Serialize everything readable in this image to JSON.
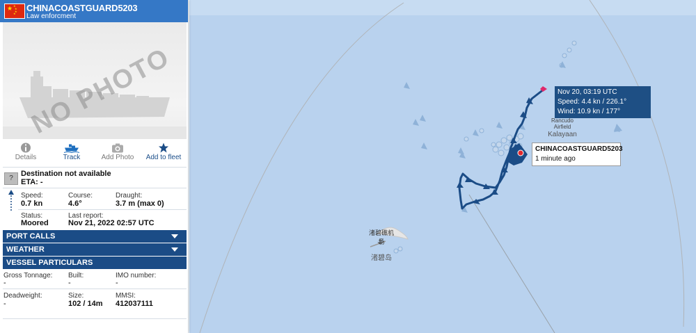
{
  "vessel": {
    "name": "CHINACOASTGUARD5203",
    "type": "Law enforcment",
    "flag_color": "#de2910"
  },
  "photo": {
    "watermark": "NO PHOTO"
  },
  "actions": [
    {
      "label": "Details",
      "icon": "info-icon"
    },
    {
      "label": "Track",
      "icon": "ship-icon"
    },
    {
      "label": "Add Photo",
      "icon": "camera-icon"
    },
    {
      "label": "Add to fleet",
      "icon": "star-icon"
    }
  ],
  "destination": {
    "icon_text": "?",
    "text": "Destination not available",
    "eta": "ETA: -"
  },
  "nav": {
    "speed_label": "Speed:",
    "speed": "0.7 kn",
    "course_label": "Course:",
    "course": "4.6°",
    "draught_label": "Draught:",
    "draught": "3.7 m (max 0)",
    "status_label": "Status:",
    "status": "Moored",
    "report_label": "Last report:",
    "report": "Nov 21, 2022 02:57 UTC"
  },
  "sections": {
    "port_calls": "PORT CALLS",
    "weather": "WEATHER",
    "particulars": "VESSEL PARTICULARS"
  },
  "particulars": {
    "gt_label": "Gross Tonnage:",
    "gt": "-",
    "built_label": "Built:",
    "built": "-",
    "imo_label": "IMO number:",
    "imo": "-",
    "dwt_label": "Deadweight:",
    "dwt": "-",
    "size_label": "Size:",
    "size": "102 / 14m",
    "mmsi_label": "MMSI:",
    "mmsi": "412037111"
  },
  "map": {
    "track_tooltip": {
      "time": "Nov 20, 03:19 UTC",
      "speed": "Speed: 4.4 kn / 226.1°",
      "wind": "Wind: 10.9 kn / 177°"
    },
    "vessel_label": {
      "name": "CHINACOASTGUARD5203",
      "age": "1 minute ago"
    },
    "place_labels": {
      "airfield_line1": "Rancudo",
      "airfield_line2": "Airfield",
      "town": "Kalayaan",
      "island_line1": "渚碧礁机",
      "island_line2": "场",
      "island_name": "渚碧岛"
    },
    "colors": {
      "sea": "#b9d2ee",
      "track": "#1b4c86",
      "vessel": "#e0282e"
    }
  }
}
